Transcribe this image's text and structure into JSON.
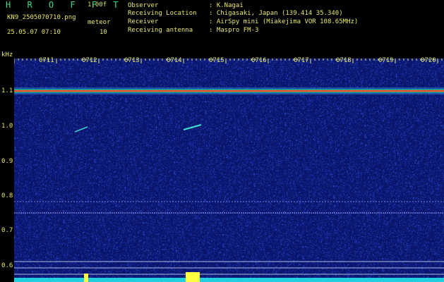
{
  "header": {
    "title": "H R O F F T",
    "version": "1.00f",
    "filename": "KN9_2505070710.png",
    "meteors_label": "meteor",
    "datetime": "25.05.07 07:10",
    "meteors_count": "10"
  },
  "info": [
    {
      "key": "Observer",
      "value": ": K.Nagai"
    },
    {
      "key": "Receiving Location",
      "value": ": Chigasaki, Japan (139.414 35.340)"
    },
    {
      "key": "Receiver",
      "value": ": AirSpy mini (Miakejima VOR 108.65MHz)"
    },
    {
      "key": "Receiving antenna",
      "value": ": Maspro FM-3"
    }
  ],
  "axis": {
    "unit": "kHz",
    "time_ticks": [
      "0711",
      "0712",
      "0713",
      "0714",
      "0715",
      "0716",
      "0717",
      "0718",
      "0719",
      "0720"
    ],
    "freq_ticks": [
      "1.1",
      "1.0",
      "0.9",
      "0.8",
      "0.7",
      "0.6"
    ]
  },
  "colors": {
    "background": "#000000",
    "spectrogram_bg": "#0a1468",
    "text": "#e8e86a",
    "title": "#3ddc84",
    "carrier_core": "#ff3030",
    "carrier_halo": "#40e070",
    "bottom_strip": "#20d0e0",
    "burst": "#ffff40"
  }
}
